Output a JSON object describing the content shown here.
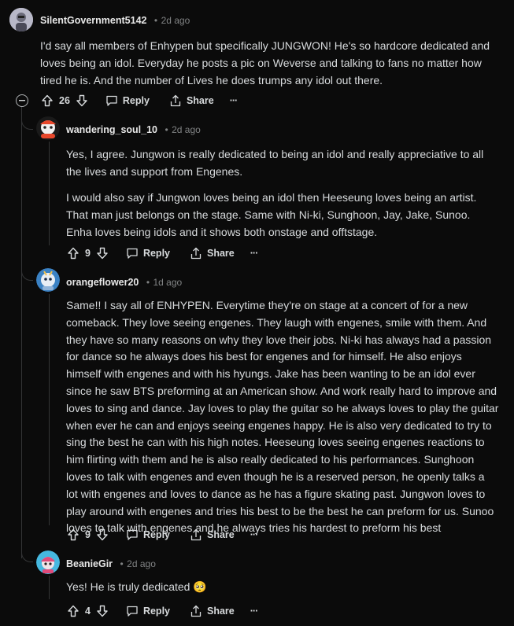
{
  "comments": [
    {
      "username": "SilentGovernment5142",
      "time": "2d ago",
      "text": "I'd say all members of Enhypen but specifically JUNGWON! He's so hardcore dedicated and loves being an idol. Everyday he posts a pic on Weverse and talking to fans no matter how tired he is. And the number of Lives he does trumps any idol out there.",
      "votes": "26",
      "reply_label": "Reply",
      "share_label": "Share",
      "more_label": "···"
    },
    {
      "username": "wandering_soul_10",
      "time": "2d ago",
      "text_p1": "Yes, I agree. Jungwon is really dedicated to being an idol and really appreciative to all the lives and support from Engenes.",
      "text_p2": "I would also say if Jungwon loves being an idol then Heeseung loves being an artist. That man just belongs on the stage. Same with Ni-ki, Sunghoon, Jay, Jake, Sunoo. Enha loves being idols and it shows both onstage and offtstage.",
      "votes": "9",
      "reply_label": "Reply",
      "share_label": "Share",
      "more_label": "···"
    },
    {
      "username": "orangeflower20",
      "time": "1d ago",
      "text": "Same!! I say all of ENHYPEN. Everytime they're on stage at a concert of for a new comeback. They love seeing engenes. They laugh with engenes, smile with them. And they have so many reasons on why they love their jobs. Ni-ki has always had a passion for dance so he always does his best for engenes and for himself. He also enjoys himself with engenes and with his hyungs. Jake has been wanting to be an idol ever since he saw BTS preforming at an American show. And work really hard to improve and loves to sing and dance. Jay loves to play the guitar so he always loves to play the guitar when ever he can and enjoys seeing engenes happy. He is also very dedicated to try to sing the best he can with his high notes. Heeseung loves seeing engenes reactions to him flirting with them and he is also really dedicated to his performances. Sunghoon loves to talk with engenes and even though he is a reserved person, he openly talks a lot with engenes and loves to dance as he has a figure skating past. Jungwon loves to play around with engenes and tries his best to be the best he can preform for us. Sunoo loves to talk with engenes and he always tries his hardest to preform his best",
      "votes": "9",
      "reply_label": "Reply",
      "share_label": "Share",
      "more_label": "···"
    },
    {
      "username": "BeanieGir",
      "time": "2d ago",
      "text": "Yes! He is truly dedicated 🥺",
      "votes": "4",
      "reply_label": "Reply",
      "share_label": "Share",
      "more_label": "···"
    }
  ],
  "separator": "•",
  "colors": {
    "background": "#0b0b0b",
    "text": "#d7dadc",
    "muted": "#818384",
    "thread": "#343536"
  },
  "icons": [
    "upvote-icon",
    "downvote-icon",
    "reply-icon",
    "share-icon",
    "collapse-icon"
  ]
}
